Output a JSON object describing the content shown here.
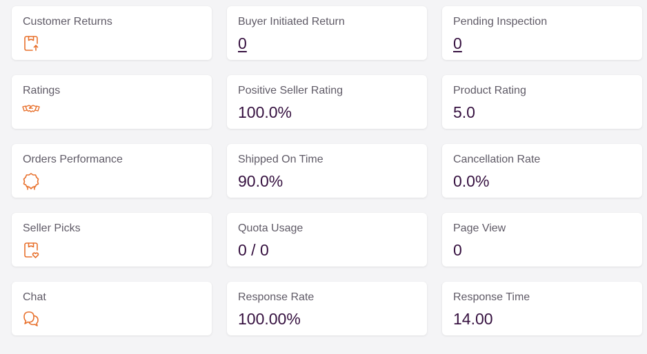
{
  "accent_color": "#e8712d",
  "value_color": "#35103f",
  "label_color": "#5f5a66",
  "rows": [
    {
      "category": {
        "label": "Customer Returns",
        "icon": "package-return-icon"
      },
      "metric1": {
        "label": "Buyer Initiated Return",
        "value": "0"
      },
      "metric2": {
        "label": "Pending Inspection",
        "value": "0"
      }
    },
    {
      "category": {
        "label": "Ratings",
        "icon": "handshake-icon"
      },
      "metric1": {
        "label": "Positive Seller Rating",
        "value": "100.0%"
      },
      "metric2": {
        "label": "Product Rating",
        "value": "5.0"
      }
    },
    {
      "category": {
        "label": "Orders Performance",
        "icon": "badge-icon"
      },
      "metric1": {
        "label": "Shipped On Time",
        "value": "90.0%"
      },
      "metric2": {
        "label": "Cancellation Rate",
        "value": "0.0%"
      }
    },
    {
      "category": {
        "label": "Seller Picks",
        "icon": "package-heart-icon"
      },
      "metric1": {
        "label": "Quota Usage",
        "value": "0 / 0"
      },
      "metric2": {
        "label": "Page View",
        "value": "0"
      }
    },
    {
      "category": {
        "label": "Chat",
        "icon": "chat-bubbles-icon"
      },
      "metric1": {
        "label": "Response Rate",
        "value": "100.00%"
      },
      "metric2": {
        "label": "Response Time",
        "value": "14.00"
      }
    }
  ]
}
